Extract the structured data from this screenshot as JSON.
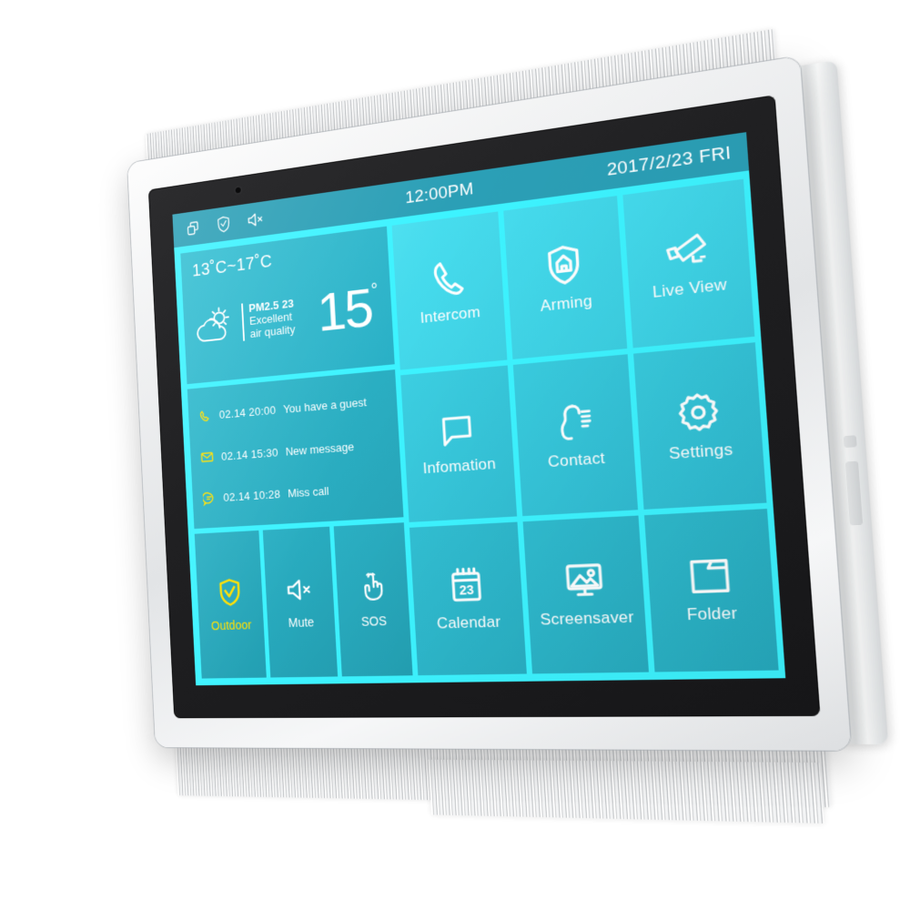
{
  "device": {
    "name": "indoor-station-touch-panel",
    "bezel_color": "#eef0f1",
    "screen_bg_color": "#3df3ff"
  },
  "status_bar": {
    "time": "12:00PM",
    "date": "2017/2/23 FRI",
    "icons": [
      {
        "name": "multi-screen-icon",
        "label": "Multi screen"
      },
      {
        "name": "shield-check-icon",
        "label": "Arming status"
      },
      {
        "name": "speaker-mute-icon",
        "label": "Mute"
      }
    ],
    "bar_color": "#2b9fb6"
  },
  "weather": {
    "range": "13˚C~17˚C",
    "pm_label": "PM2.5 23",
    "quality_line1": "Excellent",
    "quality_line2": "air quality",
    "temperature": "15",
    "degree_symbol": "°",
    "icon": "sun-behind-cloud-icon"
  },
  "messages": [
    {
      "icon": "phone-call-icon",
      "when": "02.14  20:00",
      "text": "You have a guest",
      "icon_color": "#ffe000"
    },
    {
      "icon": "envelope-icon",
      "when": "02.14  15:30",
      "text": "New message",
      "icon_color": "#ffe000"
    },
    {
      "icon": "missed-call-bubble-icon",
      "when": "02.14  10:28",
      "text": "Miss call",
      "icon_color": "#ffe000"
    }
  ],
  "quick_actions": [
    {
      "label": "Outdoor",
      "icon": "shield-check-icon",
      "active": true,
      "accent": "#ffe000"
    },
    {
      "label": "Mute",
      "icon": "speaker-mute-icon",
      "active": false,
      "accent": "#ffffff"
    },
    {
      "label": "SOS",
      "icon": "hand-touch-icon",
      "active": false,
      "accent": "#ffffff"
    }
  ],
  "apps": [
    {
      "label": "Intercom",
      "icon": "phone-handset-icon"
    },
    {
      "label": "Arming",
      "icon": "shield-home-icon"
    },
    {
      "label": "Live  View",
      "icon": "cctv-camera-icon"
    },
    {
      "label": "Infomation",
      "icon": "speech-bubble-icon"
    },
    {
      "label": "Contact",
      "icon": "contact-person-icon"
    },
    {
      "label": "Settings",
      "icon": "gear-icon"
    },
    {
      "label": "Calendar",
      "icon": "calendar-23-icon"
    },
    {
      "label": "Screensaver",
      "icon": "picture-monitor-icon"
    },
    {
      "label": "Folder",
      "icon": "folder-icon"
    }
  ]
}
